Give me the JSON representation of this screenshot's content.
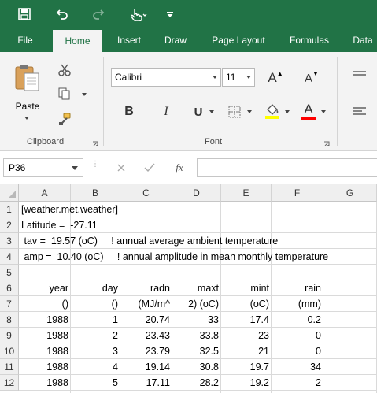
{
  "ribbon_tabs": [
    "File",
    "Home",
    "Insert",
    "Draw",
    "Page Layout",
    "Formulas",
    "Data"
  ],
  "active_tab": "Home",
  "clipboard": {
    "paste_label": "Paste",
    "group_label": "Clipboard"
  },
  "font": {
    "name": "Calibri",
    "size": "11",
    "group_label": "Font",
    "bold": "B",
    "italic": "I",
    "underline": "U",
    "grow": "A",
    "shrink": "A",
    "color_letter": "A"
  },
  "colors": {
    "accent": "#217346",
    "fill_highlight": "#ffff00",
    "font_color": "#ff0000"
  },
  "formula_bar": {
    "cell_ref": "P36",
    "fx": "fx",
    "value": ""
  },
  "columns": [
    "A",
    "B",
    "C",
    "D",
    "E",
    "F",
    "G"
  ],
  "rows": [
    {
      "num": "1",
      "cells": [
        "[weather.met.weather]",
        "",
        "",
        "",
        "",
        "",
        ""
      ]
    },
    {
      "num": "2",
      "cells": [
        "Latitude =  -27.11",
        "",
        "",
        "",
        "",
        "",
        ""
      ]
    },
    {
      "num": "3",
      "cells": [
        " tav =  19.57 (oC)     ! annual average ambient temperature",
        "",
        "",
        "",
        "",
        "",
        ""
      ]
    },
    {
      "num": "4",
      "cells": [
        " amp =  10.40 (oC)     ! annual amplitude in mean monthly temperature",
        "",
        "",
        "",
        "",
        "",
        ""
      ]
    },
    {
      "num": "5",
      "cells": [
        "",
        "",
        "",
        "",
        "",
        "",
        ""
      ]
    },
    {
      "num": "6",
      "cells": [
        "year",
        "day",
        "radn",
        "maxt",
        "mint",
        "rain",
        ""
      ]
    },
    {
      "num": "7",
      "cells": [
        "()",
        "()",
        "(MJ/m^",
        "2) (oC)",
        "(oC)",
        "(mm)",
        ""
      ]
    },
    {
      "num": "8",
      "cells": [
        "1988",
        "1",
        "20.74",
        "33",
        "17.4",
        "0.2",
        ""
      ]
    },
    {
      "num": "9",
      "cells": [
        "1988",
        "2",
        "23.43",
        "33.8",
        "23",
        "0",
        ""
      ]
    },
    {
      "num": "10",
      "cells": [
        "1988",
        "3",
        "23.79",
        "32.5",
        "21",
        "0",
        ""
      ]
    },
    {
      "num": "11",
      "cells": [
        "1988",
        "4",
        "19.14",
        "30.8",
        "19.7",
        "34",
        ""
      ]
    },
    {
      "num": "12",
      "cells": [
        "1988",
        "5",
        "17.11",
        "28.2",
        "19.2",
        "2",
        ""
      ]
    }
  ]
}
